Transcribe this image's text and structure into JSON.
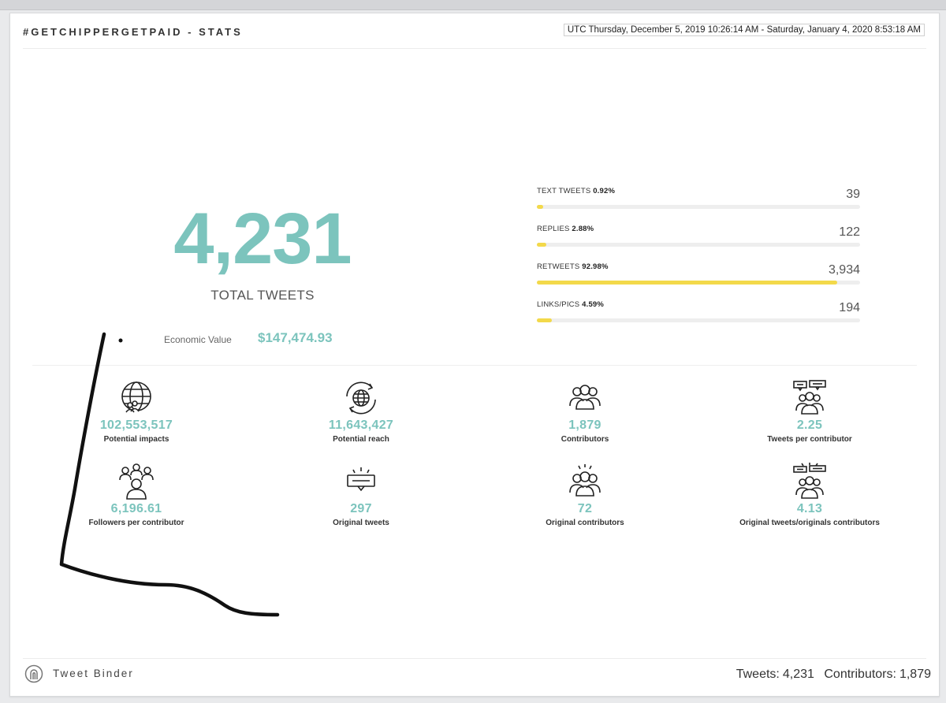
{
  "header": {
    "title": "#GETCHIPPERGETPAID - STATS",
    "date_range": "UTC Thursday, December 5, 2019 10:26:14 AM - Saturday, January 4, 2020 8:53:18 AM"
  },
  "totals": {
    "total_tweets": "4,231",
    "total_tweets_label": "TOTAL TWEETS",
    "economic_value_label": "Economic Value",
    "economic_value": "$147,474.93"
  },
  "breakdown": [
    {
      "label": "TEXT TWEETS",
      "percent": "0.92%",
      "count": "39",
      "fill_percent": 0.92
    },
    {
      "label": "REPLIES",
      "percent": "2.88%",
      "count": "122",
      "fill_percent": 2.88
    },
    {
      "label": "RETWEETS",
      "percent": "92.98%",
      "count": "3,934",
      "fill_percent": 92.98
    },
    {
      "label": "LINKS/PICS",
      "percent": "4.59%",
      "count": "194",
      "fill_percent": 4.59
    }
  ],
  "stats": [
    {
      "icon": "globe-people-icon",
      "value": "102,553,517",
      "label": "Potential impacts"
    },
    {
      "icon": "globe-refresh-icon",
      "value": "11,643,427",
      "label": "Potential reach"
    },
    {
      "icon": "group-icon",
      "value": "1,879",
      "label": "Contributors"
    },
    {
      "icon": "group-chat-icon",
      "value": "2.25",
      "label": "Tweets per contributor"
    },
    {
      "icon": "followers-icon",
      "value": "6,196.61",
      "label": "Followers per contributor"
    },
    {
      "icon": "tweet-bubble-icon",
      "value": "297",
      "label": "Original tweets"
    },
    {
      "icon": "group-spark-icon",
      "value": "72",
      "label": "Original contributors"
    },
    {
      "icon": "group-chat-spark-icon",
      "value": "4.13",
      "label": "Original tweets/originals contributors"
    }
  ],
  "footer": {
    "brand": "Tweet Binder",
    "tweets_label": "Tweets:",
    "tweets_value": "4,231",
    "contributors_label": "Contributors:",
    "contributors_value": "1,879"
  },
  "colors": {
    "accent": "#7cc4bd",
    "bar_fill": "#f3d94a",
    "bar_track": "#eeeeee"
  }
}
